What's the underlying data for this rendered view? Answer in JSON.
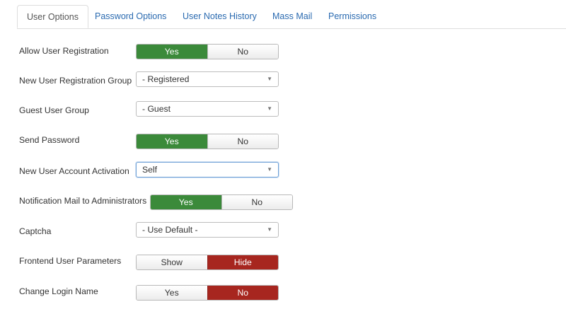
{
  "tabs": [
    {
      "label": "User Options"
    },
    {
      "label": "Password Options"
    },
    {
      "label": "User Notes History"
    },
    {
      "label": "Mass Mail"
    },
    {
      "label": "Permissions"
    }
  ],
  "fields": {
    "allow_registration": {
      "label": "Allow User Registration",
      "options": [
        "Yes",
        "No"
      ],
      "selected": "Yes"
    },
    "registration_group": {
      "label": "New User Registration Group",
      "value": "- Registered"
    },
    "guest_group": {
      "label": "Guest User Group",
      "value": "- Guest"
    },
    "send_password": {
      "label": "Send Password",
      "options": [
        "Yes",
        "No"
      ],
      "selected": "Yes"
    },
    "account_activation": {
      "label": "New User Account Activation",
      "value": "Self"
    },
    "notification_mail": {
      "label": "Notification Mail to Administrators",
      "options": [
        "Yes",
        "No"
      ],
      "selected": "Yes"
    },
    "captcha": {
      "label": "Captcha",
      "value": "- Use Default -"
    },
    "frontend_params": {
      "label": "Frontend User Parameters",
      "options": [
        "Show",
        "Hide"
      ],
      "selected": "Hide"
    },
    "change_login": {
      "label": "Change Login Name",
      "options": [
        "Yes",
        "No"
      ],
      "selected": "No"
    }
  },
  "icons": {
    "dropdown_caret": "▼"
  },
  "colors": {
    "yes_green": "#3b8a3a",
    "no_red": "#a7261f",
    "link_blue": "#2a6ab0"
  }
}
